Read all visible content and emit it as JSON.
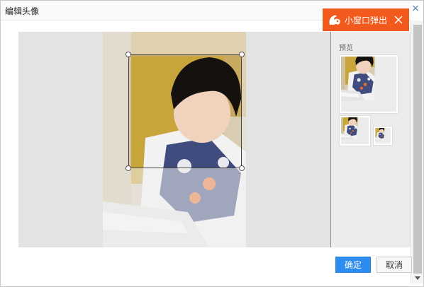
{
  "dialog": {
    "title": "编辑头像",
    "close_glyph": "×"
  },
  "uc_popup": {
    "label": "小窗口弹出",
    "logo_icon": "uc-squirrel-icon",
    "close_icon": "close-icon",
    "color": "#f25a1d"
  },
  "editor": {
    "preview_label": "预览",
    "image_subject": "photo of a young man reading a book"
  },
  "buttons": {
    "confirm": "确定",
    "cancel": "取消",
    "confirm_color": "#2d8cf0"
  }
}
